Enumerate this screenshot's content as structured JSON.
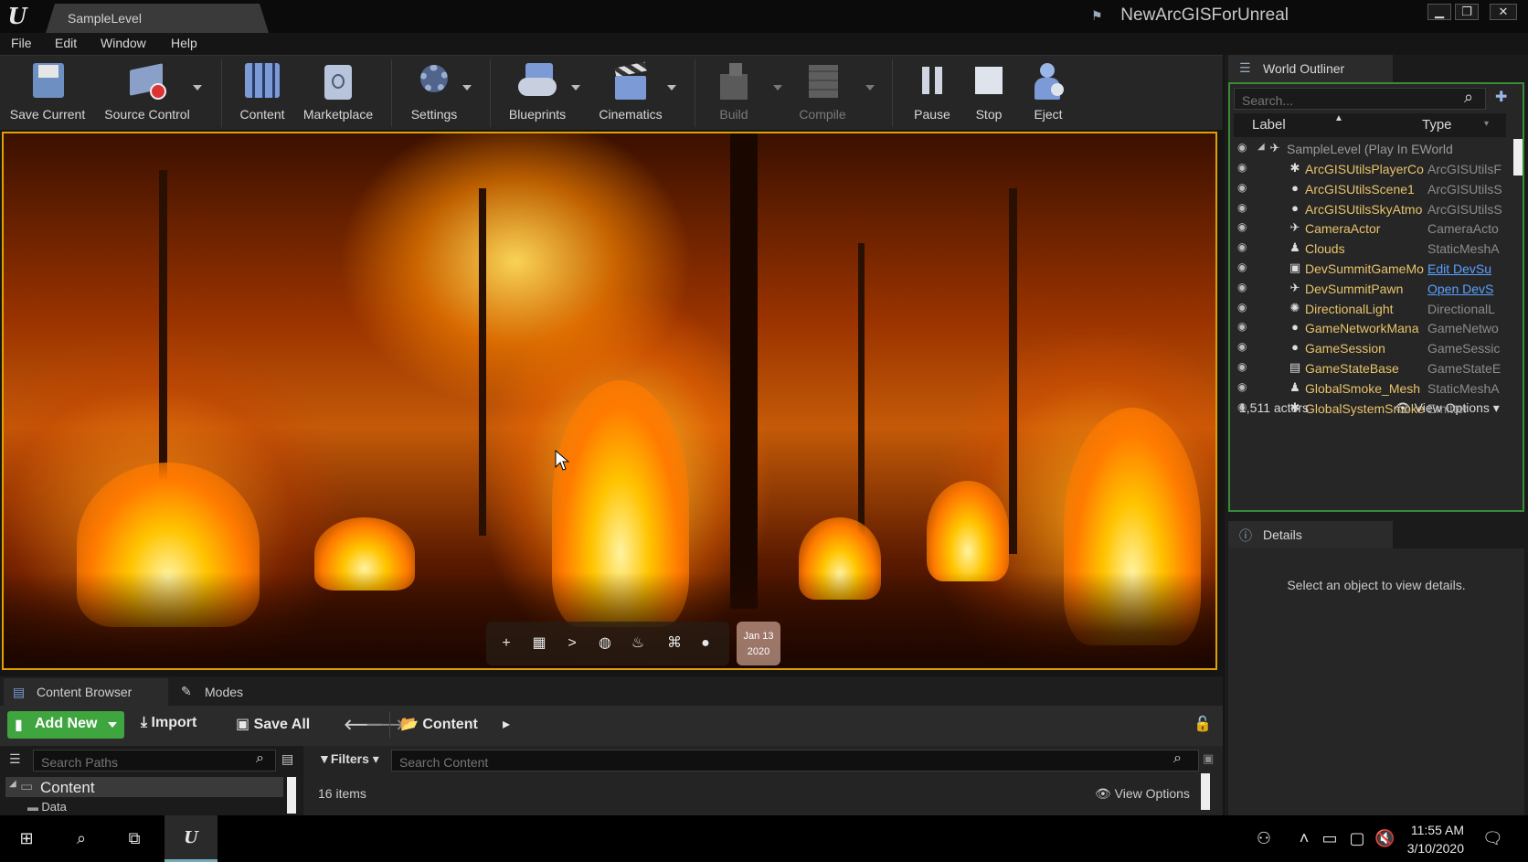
{
  "titlebar": {
    "level_tab": "SampleLevel",
    "project_name": "NewArcGISForUnreal",
    "minimize": "▁",
    "restore": "❐",
    "close": "✕"
  },
  "menu": [
    "File",
    "Edit",
    "Window",
    "Help"
  ],
  "toolbar": {
    "save_current": "Save Current",
    "source_control": "Source Control",
    "content": "Content",
    "marketplace": "Marketplace",
    "settings": "Settings",
    "blueprints": "Blueprints",
    "cinematics": "Cinematics",
    "build": "Build",
    "compile": "Compile",
    "pause": "Pause",
    "stop": "Stop",
    "eject": "Eject"
  },
  "viewport": {
    "date_line1": "Jan 13",
    "date_line2": "2020",
    "toolbar_icons": [
      "plus-icon",
      "calendar-icon",
      "play-icon",
      "globe-icon",
      "fire-icon",
      "drone-icon",
      "person-icon"
    ]
  },
  "content_browser": {
    "tab_content_browser": "Content Browser",
    "tab_modes": "Modes",
    "add_new": "Add New",
    "import": "Import",
    "save_all": "Save All",
    "path": "Content",
    "search_paths_placeholder": "Search Paths",
    "filters": "Filters",
    "search_content_placeholder": "Search Content",
    "tree_root": "Content",
    "tree_child": "Data",
    "items_count": "16 items",
    "view_options": "View Options"
  },
  "world_outliner": {
    "tab": "World Outliner",
    "search_placeholder": "Search...",
    "col_label": "Label",
    "col_type": "Type",
    "root_label": "SampleLevel (Play In EWorld",
    "rows": [
      {
        "label": "ArcGISUtilsPlayerCo",
        "type": "ArcGISUtilsF",
        "link": false
      },
      {
        "label": "ArcGISUtilsScene1",
        "type": "ArcGISUtilsS",
        "link": false
      },
      {
        "label": "ArcGISUtilsSkyAtmo",
        "type": "ArcGISUtilsS",
        "link": false
      },
      {
        "label": "CameraActor",
        "type": "CameraActo",
        "link": false
      },
      {
        "label": "Clouds",
        "type": "StaticMeshA",
        "link": false
      },
      {
        "label": "DevSummitGameMo",
        "type": "Edit DevSu",
        "link": true
      },
      {
        "label": "DevSummitPawn",
        "type": "Open DevS",
        "link": true
      },
      {
        "label": "DirectionalLight",
        "type": "DirectionalL",
        "link": false
      },
      {
        "label": "GameNetworkMana",
        "type": "GameNetwo",
        "link": false
      },
      {
        "label": "GameSession",
        "type": "GameSessic",
        "link": false
      },
      {
        "label": "GameStateBase",
        "type": "GameStateE",
        "link": false
      },
      {
        "label": "GlobalSmoke_Mesh",
        "type": "StaticMeshA",
        "link": false
      },
      {
        "label": "GlobalSystemSmoke",
        "type": "Emitter",
        "link": false
      }
    ],
    "actors_count": "1,511 actors",
    "view_options": "View Options"
  },
  "details": {
    "tab": "Details",
    "message": "Select an object to view details."
  },
  "taskbar": {
    "time": "11:55 AM",
    "date": "3/10/2020"
  }
}
